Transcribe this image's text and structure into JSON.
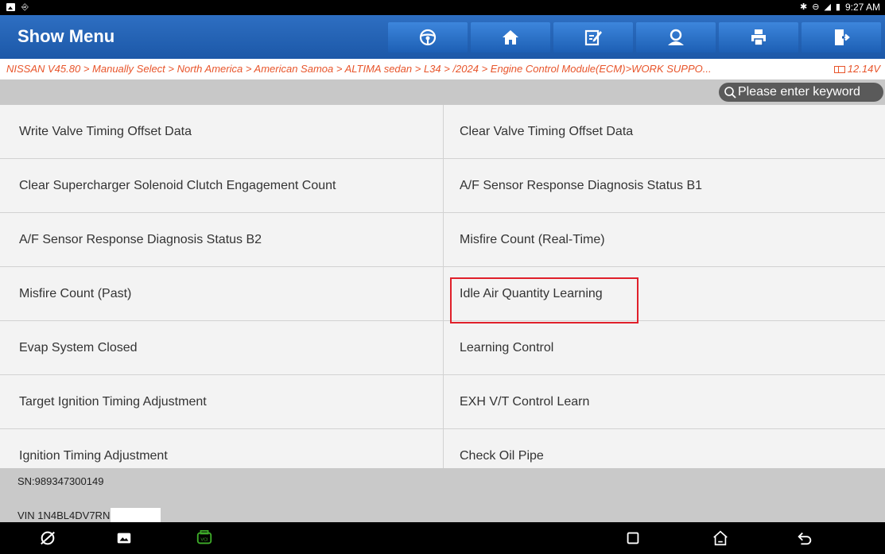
{
  "statusbar": {
    "time": "9:27 AM",
    "icons": [
      "image-icon",
      "usb-icon",
      "bluetooth-icon",
      "dnd-icon",
      "signal-icon",
      "battery-icon"
    ]
  },
  "header": {
    "title": "Show Menu",
    "toolbar": [
      "steering-wheel-icon",
      "home-icon",
      "edit-icon",
      "user-icon",
      "print-icon",
      "exit-icon"
    ]
  },
  "breadcrumb": {
    "path": "NISSAN V45.80 > Manually Select > North America > American Samoa > ALTIMA sedan > L34 > /2024 > Engine Control Module(ECM)>WORK SUPPO...",
    "voltage": "12.14V"
  },
  "search": {
    "placeholder": "Please enter keyword"
  },
  "menu": {
    "items": [
      "Write Valve Timing Offset Data",
      "Clear Valve Timing Offset Data",
      "Clear Supercharger Solenoid Clutch Engagement Count",
      "A/F Sensor Response Diagnosis Status B1",
      "A/F Sensor Response Diagnosis Status B2",
      "Misfire Count (Real-Time)",
      "Misfire Count (Past)",
      "Idle Air Quantity Learning",
      "Evap System Closed",
      "Learning Control",
      "Target Ignition Timing Adjustment",
      "EXH V/T Control Learn",
      "Ignition Timing Adjustment",
      "Check Oil Pipe"
    ],
    "highlighted": "Idle Air Quantity Learning"
  },
  "footer": {
    "sn": "SN:989347300149",
    "vin": "VIN 1N4BL4DV7RN"
  },
  "navbar": {
    "icons": [
      "browser-icon",
      "gallery-icon",
      "vci-icon",
      "recents-icon",
      "home-nav-icon",
      "back-icon"
    ],
    "vci_label": "VCI"
  },
  "colors": {
    "header_blue": "#1c58a8",
    "breadcrumb_orange": "#e8552b",
    "highlight_red": "#e0202a",
    "vci_green": "#3fae2a"
  }
}
